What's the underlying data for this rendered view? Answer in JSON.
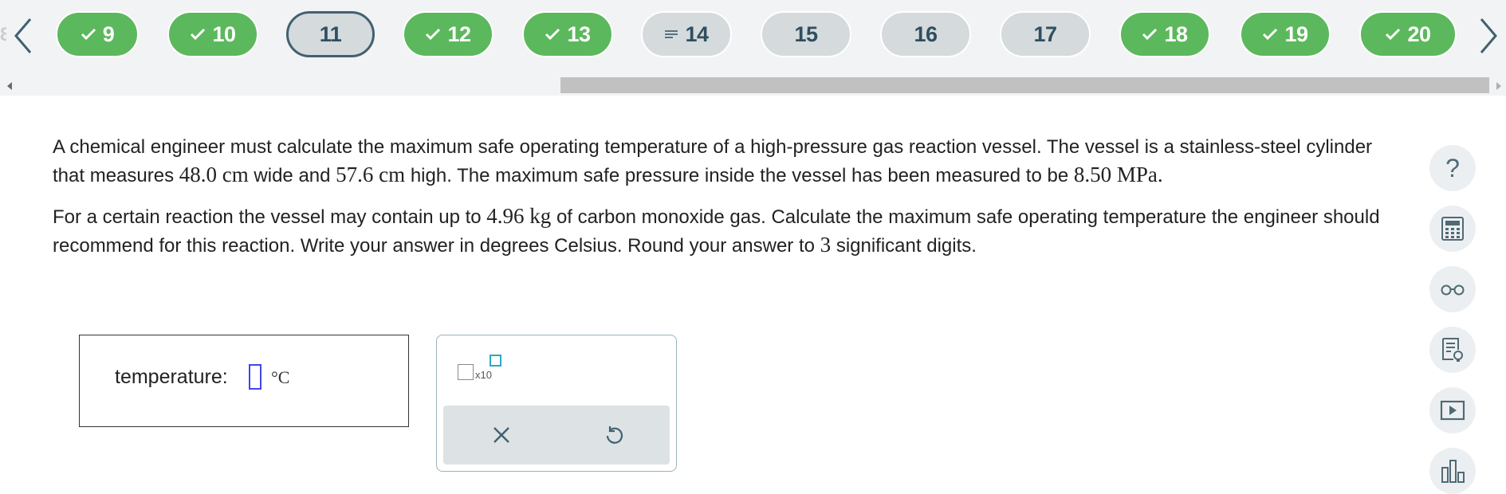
{
  "nav": {
    "partial_prev": "8",
    "prev_icon": "chevron-left-icon",
    "next_icon": "chevron-right-icon",
    "items": [
      {
        "label": "9",
        "state": "done"
      },
      {
        "label": "10",
        "state": "done"
      },
      {
        "label": "11",
        "state": "current"
      },
      {
        "label": "12",
        "state": "done"
      },
      {
        "label": "13",
        "state": "done"
      },
      {
        "label": "14",
        "state": "partial"
      },
      {
        "label": "15",
        "state": "todo"
      },
      {
        "label": "16",
        "state": "todo"
      },
      {
        "label": "17",
        "state": "todo"
      },
      {
        "label": "18",
        "state": "done"
      },
      {
        "label": "19",
        "state": "done"
      },
      {
        "label": "20",
        "state": "done"
      }
    ]
  },
  "question": {
    "p1_a": "A chemical engineer must calculate the maximum safe operating temperature of a high-pressure gas reaction vessel. The vessel is a stainless-steel cylinder that measures ",
    "width_val": "48.0 cm",
    "p1_b": " wide and ",
    "height_val": "57.6 cm",
    "p1_c": " high. The maximum safe pressure inside the vessel has been measured to be ",
    "pressure_val": "8.50 MPa",
    "p1_d": ".",
    "p2_a": "For a certain reaction the vessel may contain up to ",
    "mass_val": "4.96 kg",
    "p2_b": " of carbon monoxide gas. Calculate the maximum safe operating temperature the engineer should recommend for this reaction. Write your answer in degrees Celsius. Round your answer to ",
    "sig_val": "3",
    "p2_c": " significant digits."
  },
  "answer": {
    "label": "temperature:",
    "value": "",
    "unit": "°C"
  },
  "tools": {
    "sci_x10": "x10"
  },
  "colors": {
    "done": "#5cb85c",
    "todo": "#d5dadd",
    "current_border": "#41616f",
    "input_border": "#3f48e8"
  },
  "rail": {
    "help_label": "?",
    "items": [
      "help-icon",
      "calculator-icon",
      "glasses-icon",
      "notes-icon",
      "video-icon",
      "chart-icon"
    ]
  }
}
